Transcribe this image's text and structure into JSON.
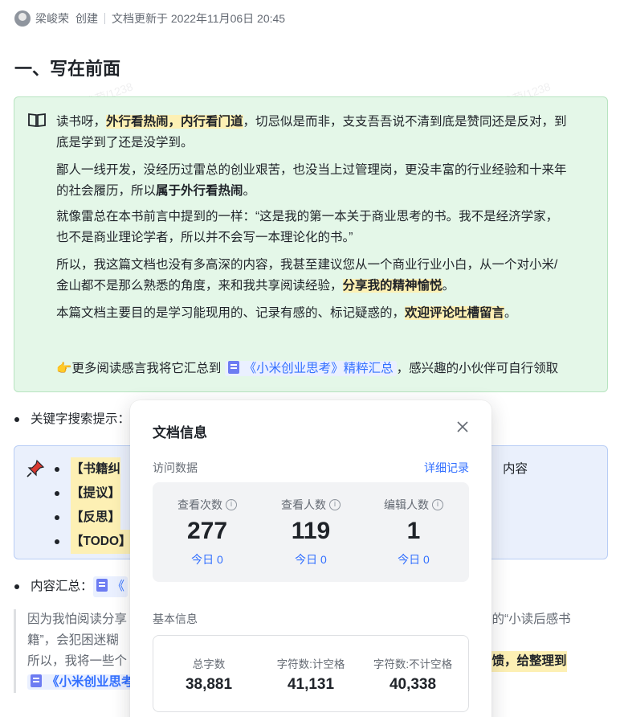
{
  "meta": {
    "author": "梁峻荣",
    "action": "创建",
    "updated": "文档更新于 2022年11月06日 20:45"
  },
  "heading": "一、写在前面",
  "callout": {
    "icon": "book-icon",
    "p1_a": "读书呀，",
    "p1_hl": "外行看热闹，内行看门道",
    "p1_b": "，切忌似是而非，支支吾吾说不清到底是赞同还是反对，到",
    "p1_c": "底是学到了还是没学到。",
    "p2_a": "鄙人一线开发，没经历过雷总的创业艰苦，也没当上过管理岗，更没丰富的行业经验和十来年",
    "p2_b": "的社会履历，所以",
    "p2_bold": "属于外行看热闹",
    "p2_end": "。",
    "p3_a": "就像雷总在本书前言中提到的一样：“这是我的第一本关于商业思考的书。我不是经济学家，",
    "p3_b": "也不是商业理论学者，所以并不会写一本理论化的书。”",
    "p4_a": "所以，我这篇文档也没有多高深的内容，我甚至建议您从一个商业行业小白，从一个对小米/",
    "p4_b": "金山都不是那么熟悉的角度，来和我共享阅读经验，",
    "p4_hl": "分享我的精神愉悦",
    "p4_end": "。",
    "p5_a": "本篇文档主要目的是学习能现用的、记录有感的、标记疑惑的，",
    "p5_hl": "欢迎评论吐槽留言",
    "p5_end": "。",
    "p6_a": "更多阅读感言我将它汇总到",
    "p6_ref": "《小米创业思考》精粹汇总",
    "p6_b": "，感兴趣的小伙伴可自行领取"
  },
  "keyword_bullet": "关键字搜索提示：",
  "keyword_list": {
    "items": [
      "【书籍纠",
      "【提议】",
      "【反思】",
      "【TODO】"
    ],
    "tail": "内容"
  },
  "summary_bullet": {
    "label": "内容汇总：",
    "ref": "《"
  },
  "quote": {
    "r1_a": "因为我怕阅读分享",
    "r1_b": "上的“小读后感书",
    "r2_a": "籍”，会犯困迷糊",
    "r3_a": "所以，我将一些个",
    "r3_b": "反馈，给整理到",
    "r4_ref": "《小米创业思考"
  },
  "modal": {
    "title": "文档信息",
    "visit_section": "访问数据",
    "detail_link": "详细记录",
    "stats": [
      {
        "label": "查看次数",
        "value": "277",
        "today": "今日 0"
      },
      {
        "label": "查看人数",
        "value": "119",
        "today": "今日 0"
      },
      {
        "label": "编辑人数",
        "value": "1",
        "today": "今日 0"
      }
    ],
    "basic_section": "基本信息",
    "basic": [
      {
        "label": "总字数",
        "value": "38,881"
      },
      {
        "label": "字符数:计空格",
        "value": "41,131"
      },
      {
        "label": "字符数:不计空格",
        "value": "40,338"
      }
    ]
  },
  "watermark": "梁峻荣/1238"
}
